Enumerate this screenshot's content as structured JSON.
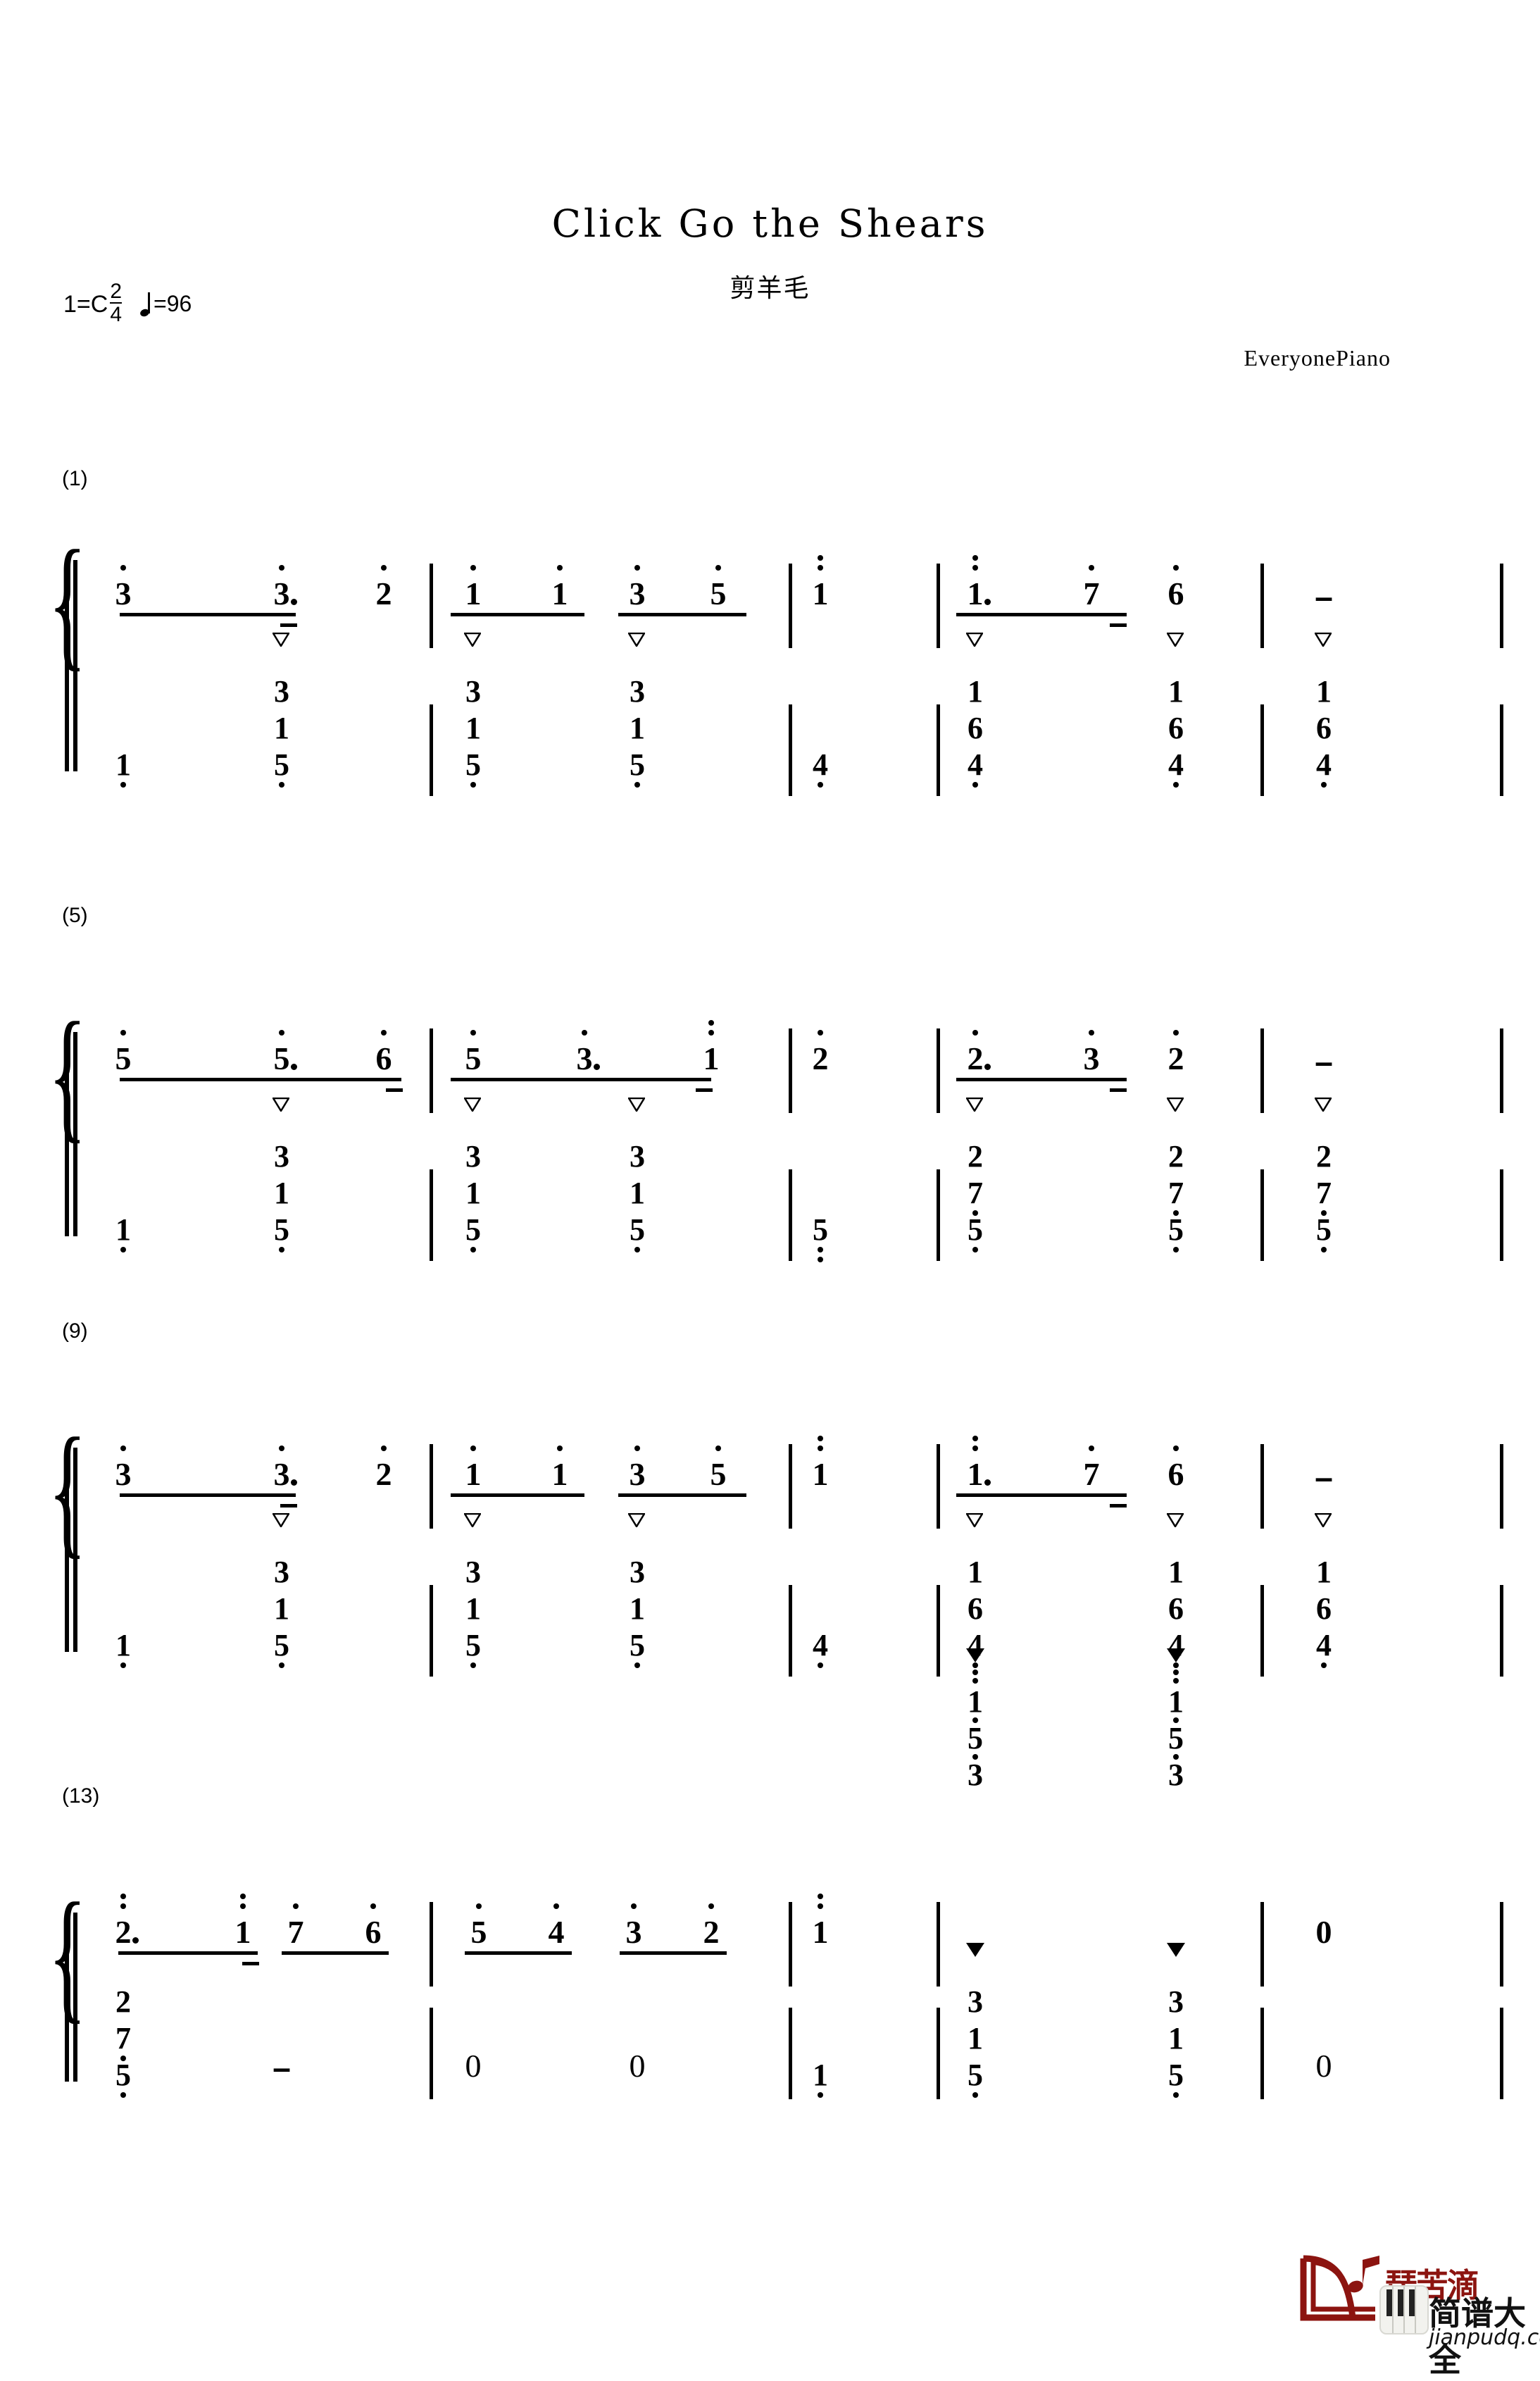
{
  "header": {
    "title": "Click Go the Shears",
    "subtitle": "剪羊毛",
    "credit": "EveryonePiano",
    "key_label": "1=C",
    "time_numerator": "2",
    "time_denominator": "4",
    "tempo_text": "=96",
    "tempo_note": "quarter-note"
  },
  "watermark": {
    "brand_cn_top": "琵苦滴",
    "brand_cn": "简谱大全",
    "url": "jianpudq.com",
    "brand_color": "#8c1410"
  },
  "systems": [
    {
      "number": "(1)",
      "melody": [
        {
          "n": "3",
          "oct_up": 1
        },
        {
          "n": "3",
          "oct_up": 1,
          "dotted": true
        },
        {
          "n": "2",
          "oct_up": 1
        },
        {
          "n": "1",
          "oct_up": 1
        },
        {
          "n": "1",
          "oct_up": 1
        },
        {
          "n": "3",
          "oct_up": 1
        },
        {
          "n": "5",
          "oct_up": 1
        },
        {
          "n": "1",
          "oct_up": 2
        },
        {
          "n": "1",
          "oct_up": 2,
          "dotted": true
        },
        {
          "n": "7",
          "oct_up": 1
        },
        {
          "n": "6",
          "oct_up": 1
        },
        {
          "n": "-"
        }
      ],
      "bass": [
        {
          "stack": [
            "1"
          ],
          "low": [
            1
          ]
        },
        {
          "stack": [
            "3",
            "1",
            "5"
          ],
          "low": [
            0,
            0,
            1
          ],
          "tri": "open"
        },
        {
          "stack": [
            "3",
            "1",
            "5"
          ],
          "low": [
            0,
            0,
            1
          ],
          "tri": "open"
        },
        {
          "stack": [
            "3",
            "1",
            "5"
          ],
          "low": [
            0,
            0,
            1
          ],
          "tri": "open"
        },
        {
          "stack": [
            "4"
          ],
          "low": [
            1
          ]
        },
        {
          "stack": [
            "1",
            "6",
            "4"
          ],
          "low": [
            0,
            0,
            1
          ],
          "tri": "open"
        },
        {
          "stack": [
            "1",
            "6",
            "4"
          ],
          "low": [
            0,
            0,
            1
          ],
          "tri": "open"
        },
        {
          "stack": [
            "1",
            "6",
            "4"
          ],
          "low": [
            0,
            0,
            1
          ],
          "tri": "open"
        }
      ]
    },
    {
      "number": "(5)",
      "melody": [
        {
          "n": "5",
          "oct_up": 1
        },
        {
          "n": "5",
          "oct_up": 1,
          "dotted": true
        },
        {
          "n": "6",
          "oct_up": 1
        },
        {
          "n": "5",
          "oct_up": 1
        },
        {
          "n": "3",
          "oct_up": 1,
          "dotted": true
        },
        {
          "n": "1",
          "oct_up": 2
        },
        {
          "n": "2",
          "oct_up": 1
        },
        {
          "n": "2",
          "oct_up": 1,
          "dotted": true
        },
        {
          "n": "3",
          "oct_up": 1
        },
        {
          "n": "2",
          "oct_up": 1
        },
        {
          "n": "-"
        }
      ],
      "bass": [
        {
          "stack": [
            "1"
          ],
          "low": [
            1
          ]
        },
        {
          "stack": [
            "3",
            "1",
            "5"
          ],
          "low": [
            0,
            0,
            1
          ],
          "tri": "open"
        },
        {
          "stack": [
            "3",
            "1",
            "5"
          ],
          "low": [
            0,
            0,
            1
          ],
          "tri": "open"
        },
        {
          "stack": [
            "3",
            "1",
            "5"
          ],
          "low": [
            0,
            0,
            1
          ],
          "tri": "open"
        },
        {
          "stack": [
            "5"
          ],
          "low": [
            2
          ]
        },
        {
          "stack": [
            "2",
            "7",
            "5"
          ],
          "low": [
            0,
            1,
            1
          ],
          "tri": "open"
        },
        {
          "stack": [
            "2",
            "7",
            "5"
          ],
          "low": [
            0,
            1,
            1
          ],
          "tri": "open"
        },
        {
          "stack": [
            "2",
            "7",
            "5"
          ],
          "low": [
            0,
            1,
            1
          ],
          "tri": "open"
        }
      ]
    },
    {
      "number": "(9)",
      "melody": [
        {
          "n": "3",
          "oct_up": 1
        },
        {
          "n": "3",
          "oct_up": 1,
          "dotted": true
        },
        {
          "n": "2",
          "oct_up": 1
        },
        {
          "n": "1",
          "oct_up": 1
        },
        {
          "n": "1",
          "oct_up": 1
        },
        {
          "n": "3",
          "oct_up": 1
        },
        {
          "n": "5",
          "oct_up": 1
        },
        {
          "n": "1",
          "oct_up": 2
        },
        {
          "n": "1",
          "oct_up": 2,
          "dotted": true
        },
        {
          "n": "7",
          "oct_up": 1
        },
        {
          "n": "6",
          "oct_up": 1
        },
        {
          "n": "-"
        }
      ],
      "bass": [
        {
          "stack": [
            "1"
          ],
          "low": [
            1
          ]
        },
        {
          "stack": [
            "3",
            "1",
            "5"
          ],
          "low": [
            0,
            0,
            1
          ],
          "tri": "open"
        },
        {
          "stack": [
            "3",
            "1",
            "5"
          ],
          "low": [
            0,
            0,
            1
          ],
          "tri": "open"
        },
        {
          "stack": [
            "3",
            "1",
            "5"
          ],
          "low": [
            0,
            0,
            1
          ],
          "tri": "open"
        },
        {
          "stack": [
            "4"
          ],
          "low": [
            1
          ]
        },
        {
          "stack": [
            "1",
            "6",
            "4"
          ],
          "low": [
            0,
            0,
            1
          ],
          "tri": "open"
        },
        {
          "stack": [
            "1",
            "6",
            "4"
          ],
          "low": [
            0,
            0,
            1
          ],
          "tri": "open"
        },
        {
          "stack": [
            "1",
            "6",
            "4"
          ],
          "low": [
            0,
            0,
            1
          ],
          "tri": "open"
        }
      ]
    },
    {
      "number": "(13)",
      "melody": [
        {
          "n": "2",
          "oct_up": 2,
          "dotted": true
        },
        {
          "n": "1",
          "oct_up": 2
        },
        {
          "n": "7",
          "oct_up": 1
        },
        {
          "n": "6",
          "oct_up": 1
        },
        {
          "n": "5",
          "oct_up": 1
        },
        {
          "n": "4",
          "oct_up": 1
        },
        {
          "n": "3",
          "oct_up": 1
        },
        {
          "n": "2",
          "oct_up": 1
        },
        {
          "n": "1",
          "oct_up": 2
        }
      ],
      "upper_chords": [
        {
          "stack": [
            "1",
            "5",
            "3"
          ],
          "up": [
            2,
            1,
            1
          ],
          "tri": "fill"
        },
        {
          "stack": [
            "1",
            "5",
            "3"
          ],
          "up": [
            2,
            1,
            1
          ],
          "tri": "fill"
        },
        {
          "n": "0"
        }
      ],
      "bass": [
        {
          "stack": [
            "2",
            "7",
            "5"
          ],
          "low": [
            0,
            1,
            1
          ]
        },
        {
          "n": "-"
        },
        {
          "n": "0"
        },
        {
          "n": "0"
        },
        {
          "stack": [
            "1"
          ],
          "low": [
            1
          ]
        },
        {
          "stack": [
            "3",
            "1",
            "5"
          ],
          "low": [
            0,
            0,
            1
          ],
          "tri": "fill"
        },
        {
          "stack": [
            "3",
            "1",
            "5"
          ],
          "low": [
            0,
            0,
            1
          ],
          "tri": "fill"
        },
        {
          "n": "0"
        }
      ]
    }
  ]
}
